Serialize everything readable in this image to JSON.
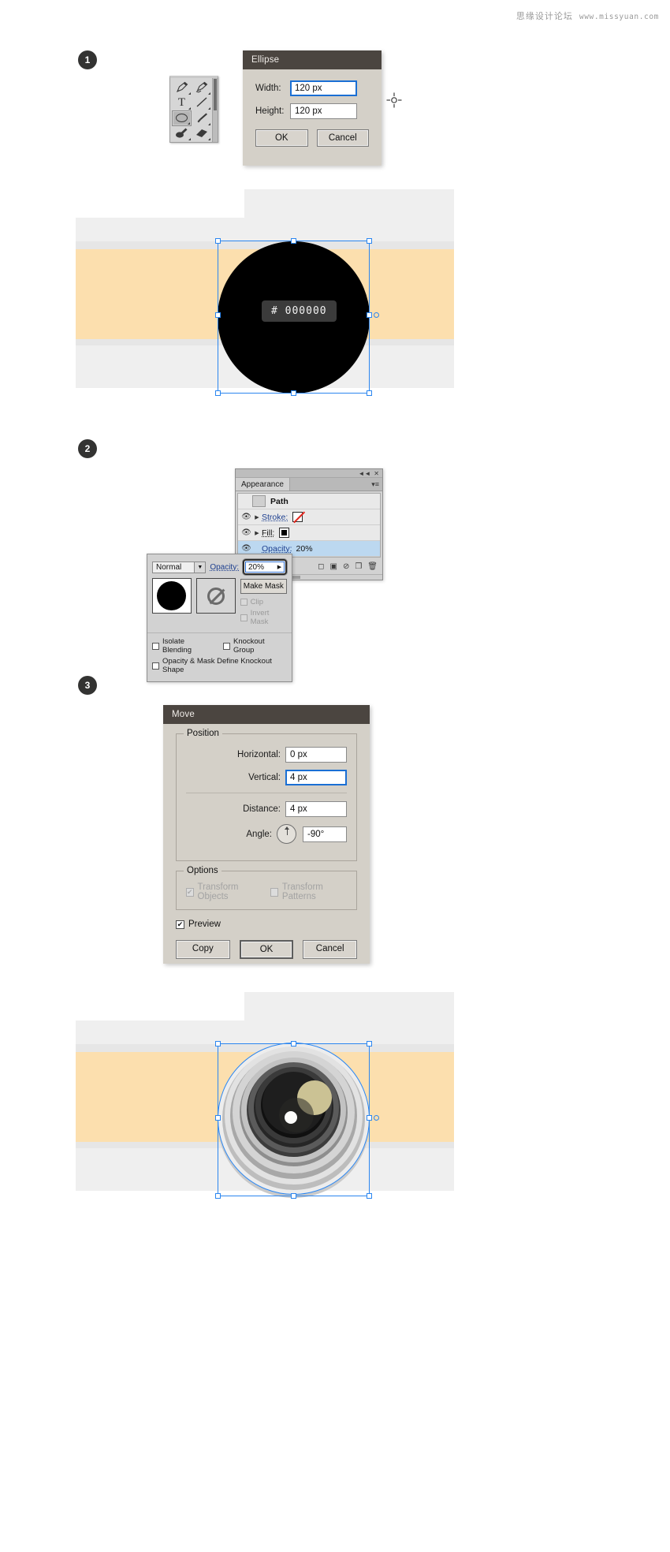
{
  "watermark": {
    "cn": "思缘设计论坛",
    "url": "www.missyuan.com"
  },
  "steps": [
    {
      "number": "1"
    },
    {
      "number": "2"
    },
    {
      "number": "3"
    }
  ],
  "toolbar": {
    "tools": [
      {
        "name": "pen-tool",
        "glyph": "✒"
      },
      {
        "name": "add-anchor-point-tool",
        "glyph": "✍"
      },
      {
        "name": "type-tool",
        "glyph": "T"
      },
      {
        "name": "line-segment-tool",
        "glyph": ""
      },
      {
        "name": "ellipse-tool",
        "glyph": ""
      },
      {
        "name": "paintbrush-tool",
        "glyph": "🖌"
      },
      {
        "name": "blob-brush-tool",
        "glyph": "🖋"
      },
      {
        "name": "eraser-tool",
        "glyph": "▰"
      }
    ],
    "selected_tool": "ellipse-tool"
  },
  "ellipse_dialog": {
    "title": "Ellipse",
    "width_label": "Width:",
    "width_value": "120 px",
    "height_label": "Height:",
    "height_value": "120 px",
    "ok_label": "OK",
    "cancel_label": "Cancel"
  },
  "appearance_panel": {
    "tab_label": "Appearance",
    "path_label": "Path",
    "rows": [
      {
        "label": "Stroke:",
        "value": "",
        "swatch": "none"
      },
      {
        "label": "Fill:",
        "value": "",
        "swatch": "black"
      },
      {
        "label": "Opacity:",
        "value": "20%",
        "swatch": ""
      }
    ]
  },
  "transparency_panel": {
    "blend_mode": "Normal",
    "opacity_label": "Opacity:",
    "opacity_value": "20%",
    "make_mask_label": "Make Mask",
    "clip_label": "Clip",
    "invert_mask_label": "Invert Mask",
    "isolate_blending_label": "Isolate Blending",
    "knockout_group_label": "Knockout Group",
    "knockout_shape_label": "Opacity & Mask Define Knockout Shape"
  },
  "move_dialog": {
    "title": "Move",
    "position_legend": "Position",
    "horizontal_label": "Horizontal:",
    "horizontal_value": "0 px",
    "vertical_label": "Vertical:",
    "vertical_value": "4 px",
    "distance_label": "Distance:",
    "distance_value": "4 px",
    "angle_label": "Angle:",
    "angle_value": "-90°",
    "options_legend": "Options",
    "transform_objects_label": "Transform Objects",
    "transform_patterns_label": "Transform Patterns",
    "preview_label": "Preview",
    "copy_label": "Copy",
    "ok_label": "OK",
    "cancel_label": "Cancel"
  },
  "artwork_1": {
    "hex_label": "# 000000",
    "fill_color": "#000000",
    "band_color": "#fcdfae",
    "body_color": "#efefef"
  },
  "artwork_2": {
    "band_color": "#fcdfae",
    "body_color": "#efefef"
  }
}
